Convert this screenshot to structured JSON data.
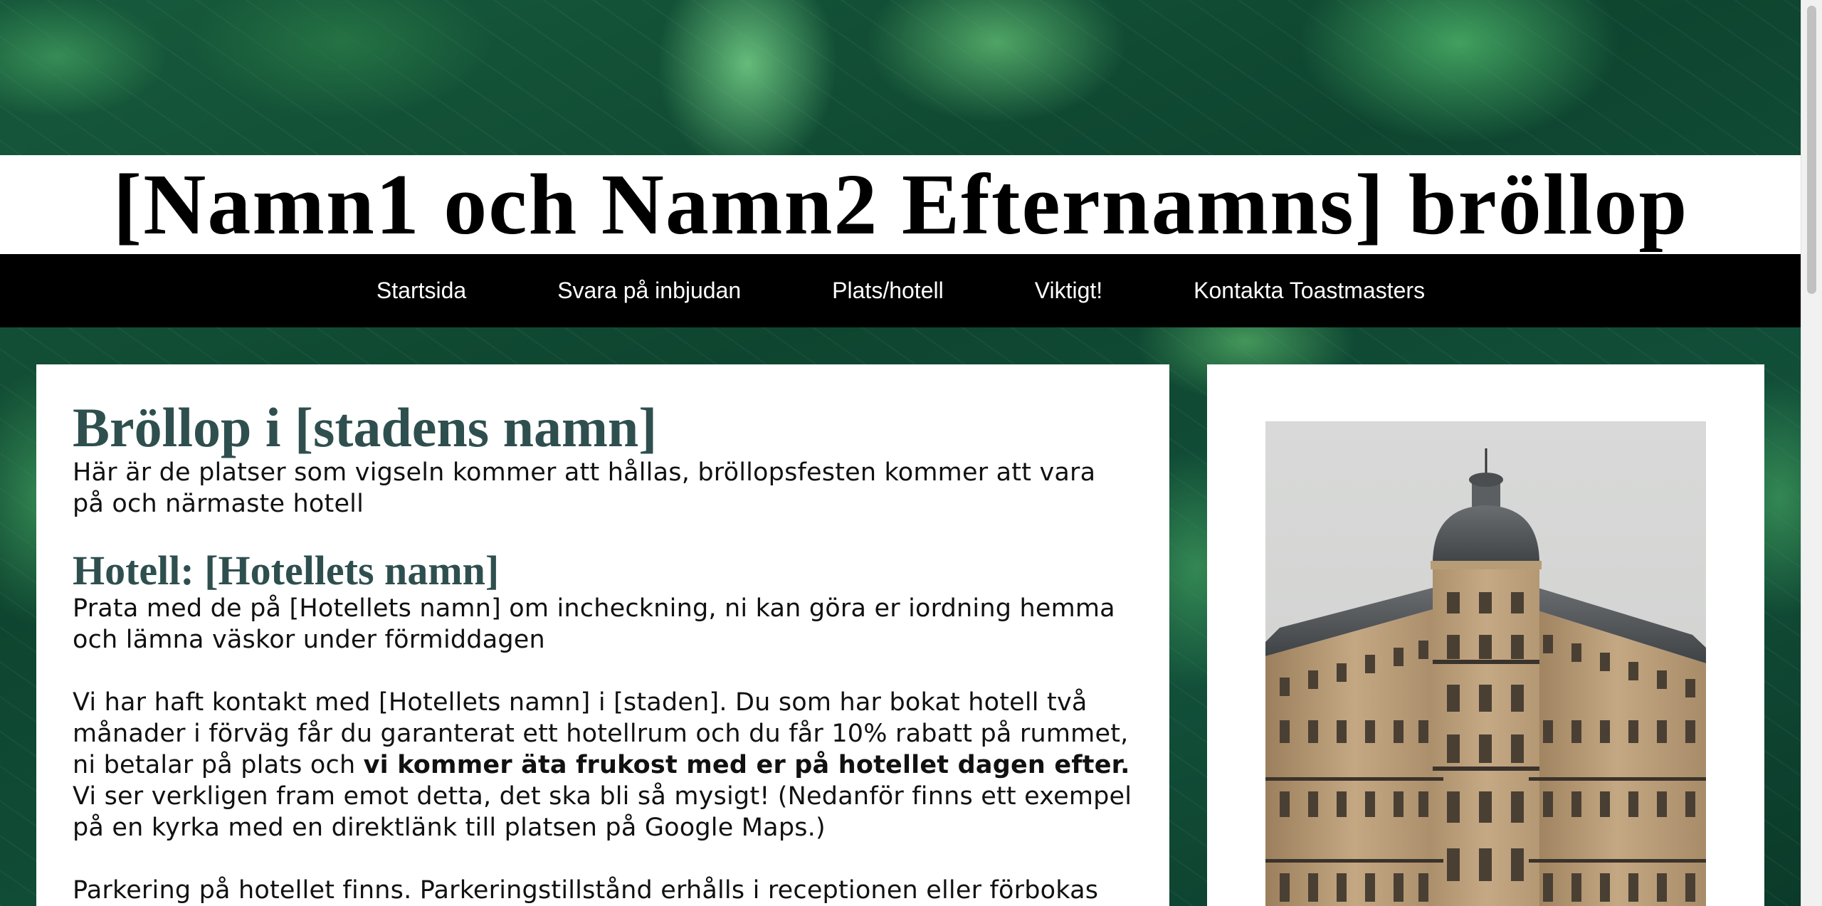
{
  "header": {
    "title": "[Namn1 och Namn2 Efternamns] bröllop"
  },
  "nav": {
    "items": [
      {
        "label": "Startsida"
      },
      {
        "label": "Svara på inbjudan"
      },
      {
        "label": "Plats/hotell"
      },
      {
        "label": "Viktigt!"
      },
      {
        "label": "Kontakta Toastmasters"
      }
    ]
  },
  "main": {
    "heading": "Bröllop i [stadens namn]",
    "intro": "Här är de platser som vigseln kommer att hållas, bröllopsfesten kommer att vara på och närmaste hotell",
    "hotel_heading": "Hotell: [Hotellets namn]",
    "hotel_text": "Prata med de på [Hotellets namn] om incheckning, ni kan göra er iordning hemma och lämna väskor under förmiddagen",
    "contact_text_1": "Vi har haft kontakt med [Hotellets namn] i [staden]. Du som har bokat hotell två månader i förväg får du garanterat ett hotellrum och du får 10% rabatt på rummet, ni betalar på plats och ",
    "contact_text_bold": "vi kommer äta frukost med er på hotellet dagen efter.",
    "contact_text_2": " Vi ser verkligen fram emot detta, det ska bli så mysigt! (Nedanför finns ett exempel på en kyrka med en direktlänk till platsen på Google Maps.)",
    "parking_text": "Parkering på hotellet finns. Parkeringstillstånd erhålls i receptionen eller förbokas"
  },
  "sidebar": {
    "image": "hotel-building-photo"
  },
  "colors": {
    "heading": "#2f4f4f",
    "nav_bg": "#000000",
    "nav_text": "#ffffff",
    "leaf_green": "#0e4530"
  }
}
